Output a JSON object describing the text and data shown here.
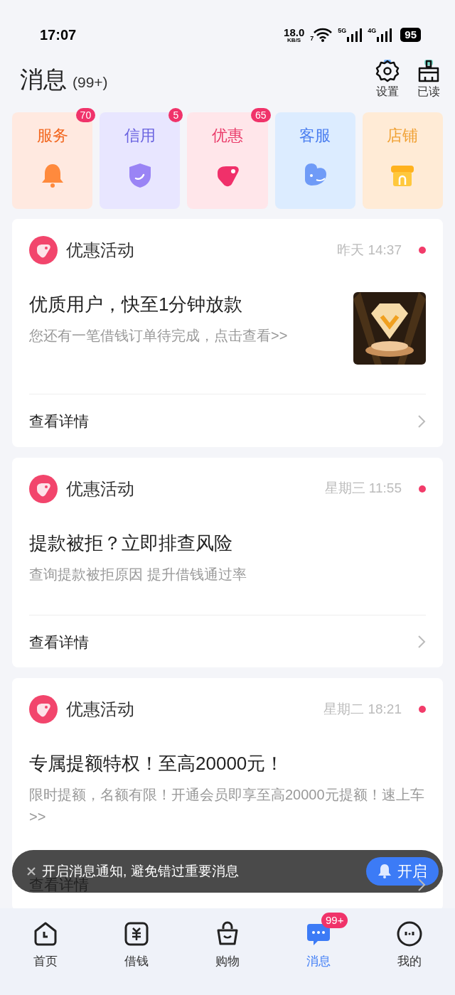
{
  "status_bar": {
    "time": "17:07",
    "speed": "18.0",
    "speed_unit": "KB/S",
    "wifi_label": "7",
    "networks": [
      "5G",
      "4G"
    ],
    "battery": "95"
  },
  "header": {
    "title": "消息",
    "count": "(99+)",
    "actions": [
      {
        "kind": "settings",
        "label": "设置"
      },
      {
        "kind": "clear",
        "label": "已读"
      }
    ]
  },
  "categories": [
    {
      "label": "服务",
      "kind": "bell",
      "badge": "70",
      "color": "#f2661e"
    },
    {
      "label": "信用",
      "kind": "shield",
      "badge": "5",
      "color": "#6a63e0"
    },
    {
      "label": "优惠",
      "kind": "tag",
      "badge": "65",
      "color": "#ea3c6a"
    },
    {
      "label": "客服",
      "kind": "chat",
      "color": "#4a7ef0"
    },
    {
      "label": "店铺",
      "kind": "shop",
      "color": "#f0a032"
    }
  ],
  "messages": [
    {
      "source": "优惠活动",
      "time": "昨天 14:37",
      "unread": true,
      "title": "优质用户，快至1分钟放款",
      "body": "您还有一笔借钱订单待完成，点击查看>>",
      "link": "查看详情"
    },
    {
      "source": "优惠活动",
      "time": "星期三 11:55",
      "unread": true,
      "title": "提款被拒？立即排查风险",
      "body": "查询提款被拒原因 提升借钱通过率",
      "link": "查看详情"
    },
    {
      "source": "优惠活动",
      "time": "星期二 18:21",
      "unread": true,
      "title": "专属提额特权！至高20000元！",
      "body": "限时提额，名额有限！开通会员即享至高20000元提额！速上车>>",
      "link": "查看详情"
    }
  ],
  "toast": {
    "text": "开启消息通知, 避免错过重要消息",
    "button": "开启"
  },
  "nav": [
    {
      "label": "首页",
      "kind": "home",
      "selected": false
    },
    {
      "label": "借钱",
      "kind": "loan",
      "selected": false
    },
    {
      "label": "购物",
      "kind": "shop",
      "selected": false
    },
    {
      "label": "消息",
      "kind": "message",
      "selected": true,
      "badge": "99+"
    },
    {
      "label": "我的",
      "kind": "me",
      "selected": false
    }
  ]
}
